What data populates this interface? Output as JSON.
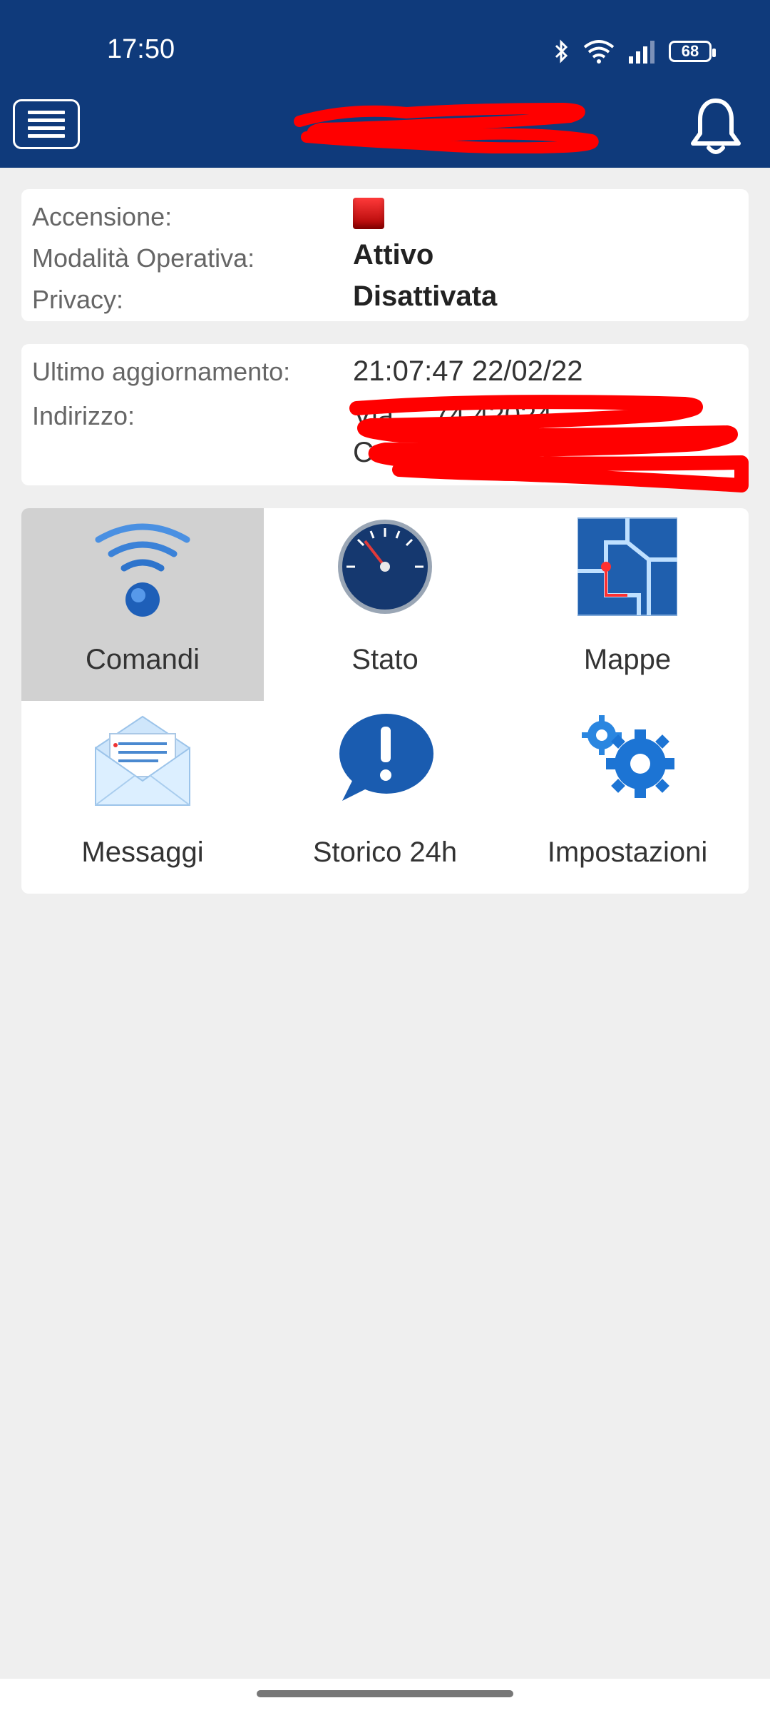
{
  "status_bar": {
    "time": "17:50",
    "battery": "68",
    "icons": [
      "bluetooth-icon",
      "wifi-icon",
      "signal-icon",
      "battery-icon"
    ]
  },
  "header": {
    "menu_icon": "hamburger-menu-icon",
    "title": "",
    "notification_icon": "bell-icon",
    "background_color": "#0f3a7b"
  },
  "status_card": {
    "rows": [
      {
        "label": "Accensione:",
        "value": "",
        "value_icon": "red-square-indicator"
      },
      {
        "label": "Modalità Operativa:",
        "value": "Attivo"
      },
      {
        "label": "Privacy:",
        "value": "Disattivata"
      }
    ]
  },
  "info_card": {
    "updated_label": "Ultimo aggiornamento:",
    "updated_value": "21:07:47 22/02/22",
    "address_label": "Indirizzo:",
    "address_line1": "Via ... 74 42024",
    "address_line2": "Ca... RE Italia"
  },
  "menu": {
    "items": [
      {
        "label": "Comandi",
        "icon": "wireless-signal-icon",
        "selected": true
      },
      {
        "label": "Stato",
        "icon": "speedometer-icon",
        "selected": false
      },
      {
        "label": "Mappe",
        "icon": "map-icon",
        "selected": false
      },
      {
        "label": "Messaggi",
        "icon": "envelope-icon",
        "selected": false
      },
      {
        "label": "Storico 24h",
        "icon": "alert-bubble-icon",
        "selected": false
      },
      {
        "label": "Impostazioni",
        "icon": "gears-icon",
        "selected": false
      }
    ]
  },
  "colors": {
    "accent_blue": "#0f3a7b",
    "page_background": "#efefef",
    "selected_tile": "#d1d1d1",
    "redaction": "#ff0000"
  }
}
